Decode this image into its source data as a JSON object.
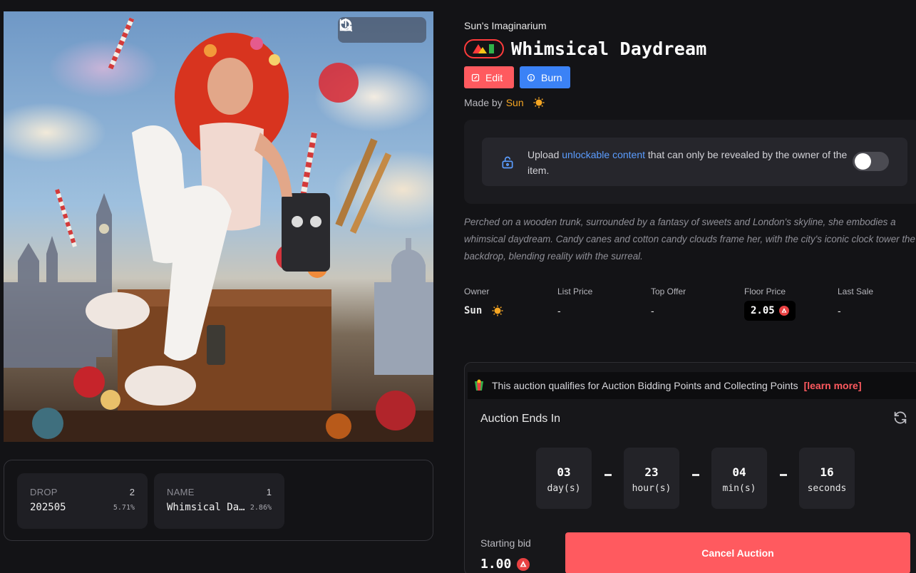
{
  "artwork": {
    "alt": "Whimsical Daydream artwork",
    "tools": {
      "refresh_icon": "refresh-icon",
      "zoom_icon": "zoom-icon",
      "share_icon": "share-icon"
    }
  },
  "traits": [
    {
      "label": "DROP",
      "count": "2",
      "value": "202505",
      "percent": "5.71%"
    },
    {
      "label": "NAME",
      "count": "1",
      "value": "Whimsical Daydream",
      "value_display": "Whimsical Da…",
      "percent": "2.86%"
    }
  ],
  "collection_name": "Sun's Imaginarium",
  "title": "Whimsical Daydream",
  "buttons": {
    "edit": "Edit",
    "burn": "Burn"
  },
  "made_by": {
    "prefix": "Made by",
    "name": "Sun"
  },
  "unlockable": {
    "text_before": "Upload",
    "link": "unlockable content",
    "text_after": "that can only be revealed by the owner of the item.",
    "enabled": false
  },
  "description": "Perched on a wooden trunk, surrounded by a fantasy of sweets and London's skyline, she embodies a whimsical daydream. Candy canes and cotton candy clouds frame her, with the city's iconic clock tower the backdrop, blending reality with the surreal.",
  "stats": {
    "owner_label": "Owner",
    "owner_value": "Sun",
    "list_price_label": "List Price",
    "list_price_value": "-",
    "top_offer_label": "Top Offer",
    "top_offer_value": "-",
    "floor_price_label": "Floor Price",
    "floor_price_value": "2.05",
    "last_sale_label": "Last Sale",
    "last_sale_value": "-"
  },
  "auction": {
    "points_text": "This auction qualifies for Auction Bidding Points and Collecting Points",
    "learn_more": "[learn more]",
    "ends_label": "Auction Ends In",
    "countdown": [
      {
        "value": "03",
        "unit": "day(s)"
      },
      {
        "value": "23",
        "unit": "hour(s)"
      },
      {
        "value": "04",
        "unit": "min(s)"
      },
      {
        "value": "16",
        "unit": "seconds"
      }
    ],
    "starting_bid_label": "Starting bid",
    "starting_bid_value": "1.00",
    "cancel_label": "Cancel Auction"
  },
  "colors": {
    "accent_red": "#ff5a5f",
    "accent_blue": "#3b82f6",
    "sun_gold": "#f5a623",
    "background": "#131316"
  }
}
